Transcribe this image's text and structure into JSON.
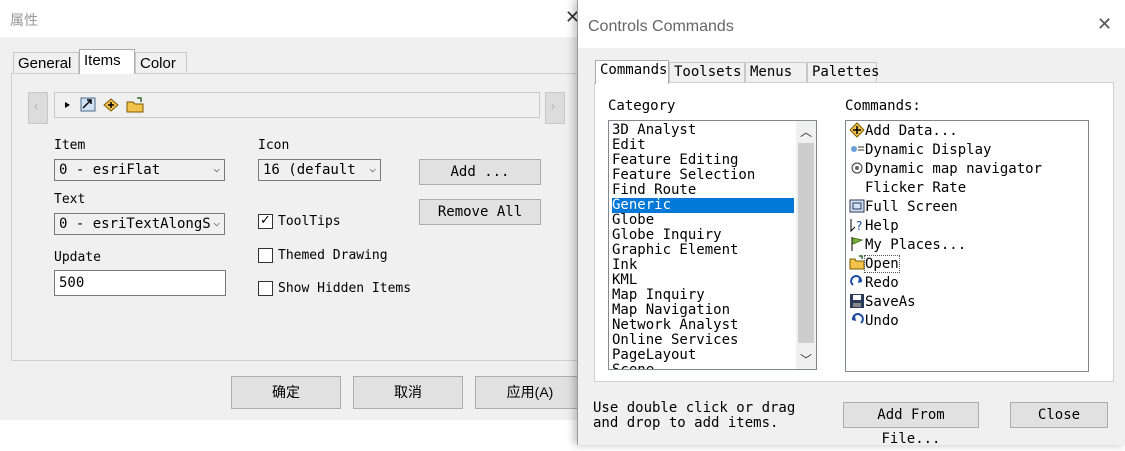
{
  "properties_dialog": {
    "title": "属性",
    "close_glyph": "✕",
    "tabs": [
      "General",
      "Items",
      "Color"
    ],
    "item_label": "Item",
    "item_value": "0 - esriFlat",
    "icon_label": "Icon",
    "icon_value": "16  (default",
    "text_label": "Text",
    "text_value": "0 - esriTextAlongS",
    "update_label": "Update",
    "update_value": "500",
    "add_button": "Add ...",
    "remove_all_button": "Remove  All",
    "tooltips_label": "ToolTips",
    "tooltips_checked": true,
    "themed_drawing_label": "Themed Drawing",
    "themed_drawing_checked": false,
    "show_hidden_items_label": "Show Hidden Items",
    "show_hidden_items_checked": false,
    "ok_button": "确定",
    "cancel_button": "取消",
    "apply_button": "应用(A)"
  },
  "commands_dialog": {
    "title": "Controls Commands",
    "close_glyph": "✕",
    "tabs": [
      "Commands",
      "Toolsets",
      "Menus",
      "Palettes"
    ],
    "category_label": "Category",
    "commands_label": "Commands:",
    "categories": [
      "3D Analyst",
      "Edit",
      "Feature Editing",
      "Feature Selection",
      "Find Route",
      "Generic",
      "Globe",
      "Globe Inquiry",
      "Graphic Element",
      "Ink",
      "KML",
      "Map Inquiry",
      "Map Navigation",
      "Network Analyst",
      "Online Services",
      "PageLayout",
      "Scene"
    ],
    "selected_category": "Generic",
    "commands": [
      {
        "label": "Add Data...",
        "icon": "add-data-icon"
      },
      {
        "label": "Dynamic Display",
        "icon": "dynamic-display-icon"
      },
      {
        "label": "Dynamic map navigator",
        "icon": "navigator-icon"
      },
      {
        "label": "Flicker Rate",
        "icon": ""
      },
      {
        "label": "Full Screen",
        "icon": "full-screen-icon"
      },
      {
        "label": "Help",
        "icon": "help-icon"
      },
      {
        "label": "My Places...",
        "icon": "flag-icon"
      },
      {
        "label": "Open",
        "icon": "open-folder-icon"
      },
      {
        "label": "Redo",
        "icon": "redo-icon"
      },
      {
        "label": "SaveAs",
        "icon": "save-icon"
      },
      {
        "label": "Undo",
        "icon": "undo-icon"
      }
    ],
    "focused_command": "Open",
    "hint": "Use double click or drag and drop to add items.",
    "add_from_file_button": "Add From File...",
    "close_button": "Close"
  }
}
